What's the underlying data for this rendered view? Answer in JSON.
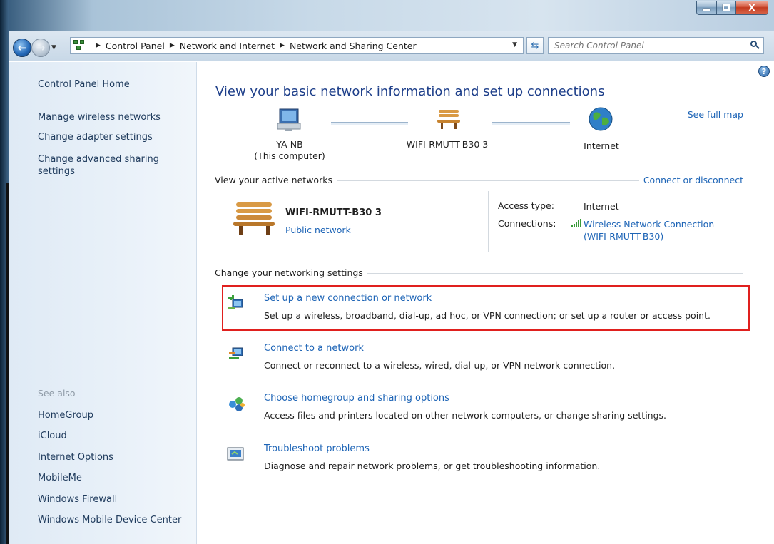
{
  "window": {
    "min_glyph": "",
    "max_glyph": "",
    "close_glyph": "X"
  },
  "address_bar": {
    "crumbs": [
      "Control Panel",
      "Network and Internet",
      "Network and Sharing Center"
    ],
    "search_placeholder": "Search Control Panel"
  },
  "left_pane": {
    "items": [
      "Control Panel Home",
      "Manage wireless networks",
      "Change adapter settings",
      "Change advanced sharing settings"
    ],
    "see_also_label": "See also",
    "see_also": [
      "HomeGroup",
      "iCloud",
      "Internet Options",
      "MobileMe",
      "Windows Firewall",
      "Windows Mobile Device Center"
    ]
  },
  "main": {
    "heading": "View your basic network information and set up connections",
    "see_full_map": "See full map",
    "map": {
      "computer_name": "YA-NB",
      "computer_sub": "(This computer)",
      "network": "WIFI-RMUTT-B30  3",
      "internet": "Internet"
    },
    "active_networks": {
      "title": "View your active networks",
      "connect_link": "Connect or disconnect",
      "network_name": "WIFI-RMUTT-B30  3",
      "network_type": "Public network",
      "access_type_label": "Access type:",
      "access_type_value": "Internet",
      "connections_label": "Connections:",
      "connection_value_1": "Wireless Network Connection",
      "connection_value_2": "(WIFI-RMUTT-B30)"
    },
    "change_settings": {
      "title": "Change your networking settings",
      "tasks": [
        {
          "title": "Set up a new connection or network",
          "desc": "Set up a wireless, broadband, dial-up, ad hoc, or VPN connection; or set up a router or access point."
        },
        {
          "title": "Connect to a network",
          "desc": "Connect or reconnect to a wireless, wired, dial-up, or VPN network connection."
        },
        {
          "title": "Choose homegroup and sharing options",
          "desc": "Access files and printers located on other network computers, or change sharing settings."
        },
        {
          "title": "Troubleshoot problems",
          "desc": "Diagnose and repair network problems, or get troubleshooting information."
        }
      ]
    }
  },
  "colors": {
    "link": "#1d64b6",
    "heading": "#1e3f8a",
    "highlight_box": "#e0201e"
  }
}
